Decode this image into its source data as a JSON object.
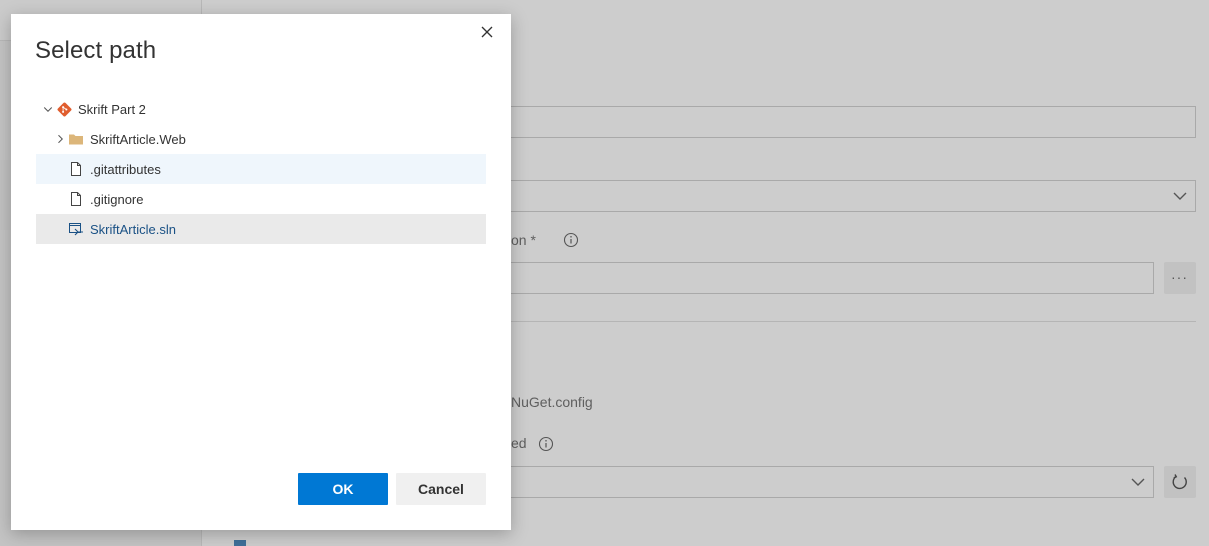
{
  "dialog": {
    "title": "Select path",
    "close_icon": "close-icon",
    "tree": {
      "root": {
        "label": "Skrift Part 2",
        "icon": "git-repo-icon",
        "expanded": true
      },
      "items": [
        {
          "label": "SkriftArticle.Web",
          "icon": "folder-icon",
          "type": "folder",
          "expanded": false
        },
        {
          "label": ".gitattributes",
          "icon": "file-icon",
          "type": "file",
          "state": "hover"
        },
        {
          "label": ".gitignore",
          "icon": "file-icon",
          "type": "file"
        },
        {
          "label": "SkriftArticle.sln",
          "icon": "solution-icon",
          "type": "file",
          "state": "selected"
        }
      ]
    },
    "ok_label": "OK",
    "cancel_label": "Cancel"
  },
  "background": {
    "partial_label_1": "on *",
    "partial_text_nuget": "NuGet.config",
    "partial_label_2": "ed",
    "ellipsis_label": "···"
  },
  "colors": {
    "accent": "#0078d4",
    "git_icon": "#e05d2e",
    "folder_icon": "#dcb67a",
    "selected_row": "#eaeaea",
    "hover_row": "#eff6fc"
  }
}
